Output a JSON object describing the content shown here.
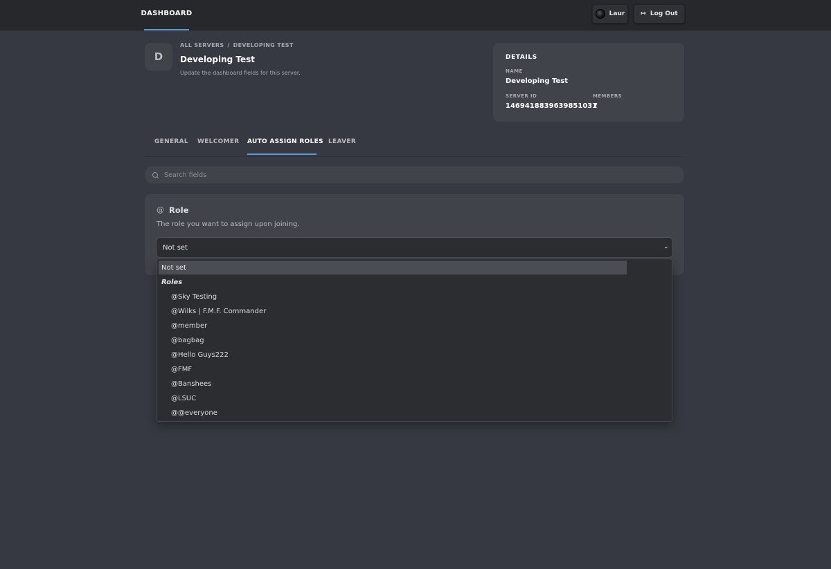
{
  "topbar": {
    "brand": "DASHBOARD",
    "user_label": "Laur",
    "logout_label": "Log Out"
  },
  "header": {
    "avatar_letter": "D",
    "breadcrumb": [
      "ALL SERVERS",
      "/",
      "DEVELOPING TEST"
    ],
    "title": "Developing Test",
    "subtitle": "Update the dashboard fields for this server."
  },
  "details": {
    "heading": "DETAILS",
    "name_label": "NAME",
    "name_value": "Developing Test",
    "server_id_label": "SERVER ID",
    "server_id_value": "1469418839639851031",
    "members_label": "MEMBERS",
    "members_value": "7"
  },
  "tabs": [
    {
      "label": "GENERAL"
    },
    {
      "label": "WELCOMER"
    },
    {
      "label": "AUTO ASSIGN ROLES"
    },
    {
      "label": "LEAVER"
    }
  ],
  "search": {
    "placeholder": "Search fields"
  },
  "role_field": {
    "icon": "@",
    "title": "Role",
    "description": "The role you want to assign upon joining.",
    "selected_value": "Not set"
  },
  "dropdown": {
    "selected_option": "Not set",
    "group_label": "Roles",
    "options": [
      "@Sky Testing",
      "@Wilks | F.M.F. Commander",
      "@member",
      "@bagbag",
      "@Hello Guys222",
      "@FMF",
      "@Banshees",
      "@LSUC",
      "@@everyone"
    ]
  },
  "colors": {
    "background": "#363941",
    "topbar": "#26282b",
    "card": "#40434a",
    "accent": "#5b9bd5"
  }
}
